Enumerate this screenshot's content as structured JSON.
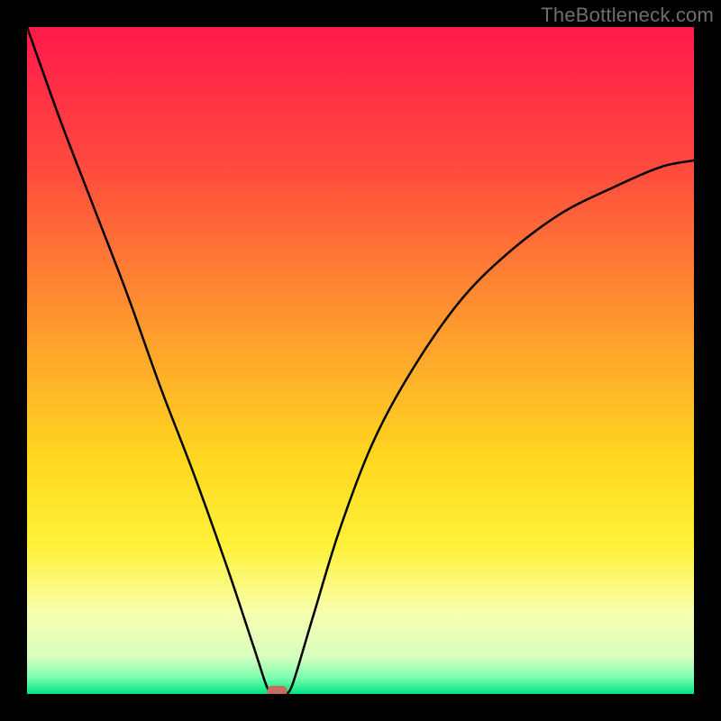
{
  "watermark": "TheBottleneck.com",
  "chart_data": {
    "type": "line",
    "title": "",
    "xlabel": "",
    "ylabel": "",
    "xlim": [
      0,
      100
    ],
    "ylim": [
      0,
      100
    ],
    "background_gradient_stops": [
      {
        "pos": 0.0,
        "color": "#ff1a4b"
      },
      {
        "pos": 0.22,
        "color": "#ff4d3d"
      },
      {
        "pos": 0.45,
        "color": "#ff9a2e"
      },
      {
        "pos": 0.65,
        "color": "#ffd81f"
      },
      {
        "pos": 0.78,
        "color": "#fff23a"
      },
      {
        "pos": 0.88,
        "color": "#f7ffb0"
      },
      {
        "pos": 0.945,
        "color": "#d7ffbf"
      },
      {
        "pos": 0.975,
        "color": "#7dffb0"
      },
      {
        "pos": 1.0,
        "color": "#00e283"
      }
    ],
    "curve_left": {
      "note": "percentage values (y) along horizontal position x from 0 to ~37; curve descends from 100 to 0",
      "points": [
        {
          "x": 0,
          "y": 100
        },
        {
          "x": 5,
          "y": 86
        },
        {
          "x": 10,
          "y": 73
        },
        {
          "x": 15,
          "y": 60
        },
        {
          "x": 20,
          "y": 46
        },
        {
          "x": 25,
          "y": 33
        },
        {
          "x": 30,
          "y": 19
        },
        {
          "x": 34,
          "y": 7
        },
        {
          "x": 36,
          "y": 1
        },
        {
          "x": 37,
          "y": 0
        }
      ]
    },
    "curve_right": {
      "note": "percentage values (y) along horizontal position x from ~39 to 100; curve rises from 0 toward ~80",
      "points": [
        {
          "x": 39,
          "y": 0
        },
        {
          "x": 40,
          "y": 2
        },
        {
          "x": 43,
          "y": 12
        },
        {
          "x": 47,
          "y": 25
        },
        {
          "x": 52,
          "y": 38
        },
        {
          "x": 58,
          "y": 49
        },
        {
          "x": 65,
          "y": 59
        },
        {
          "x": 72,
          "y": 66
        },
        {
          "x": 80,
          "y": 72
        },
        {
          "x": 88,
          "y": 76
        },
        {
          "x": 95,
          "y": 79
        },
        {
          "x": 100,
          "y": 80
        }
      ]
    },
    "marker": {
      "note": "small rounded indicator at the curve minimum",
      "x": 37.5,
      "y": 0,
      "color": "#c76b5f"
    }
  }
}
